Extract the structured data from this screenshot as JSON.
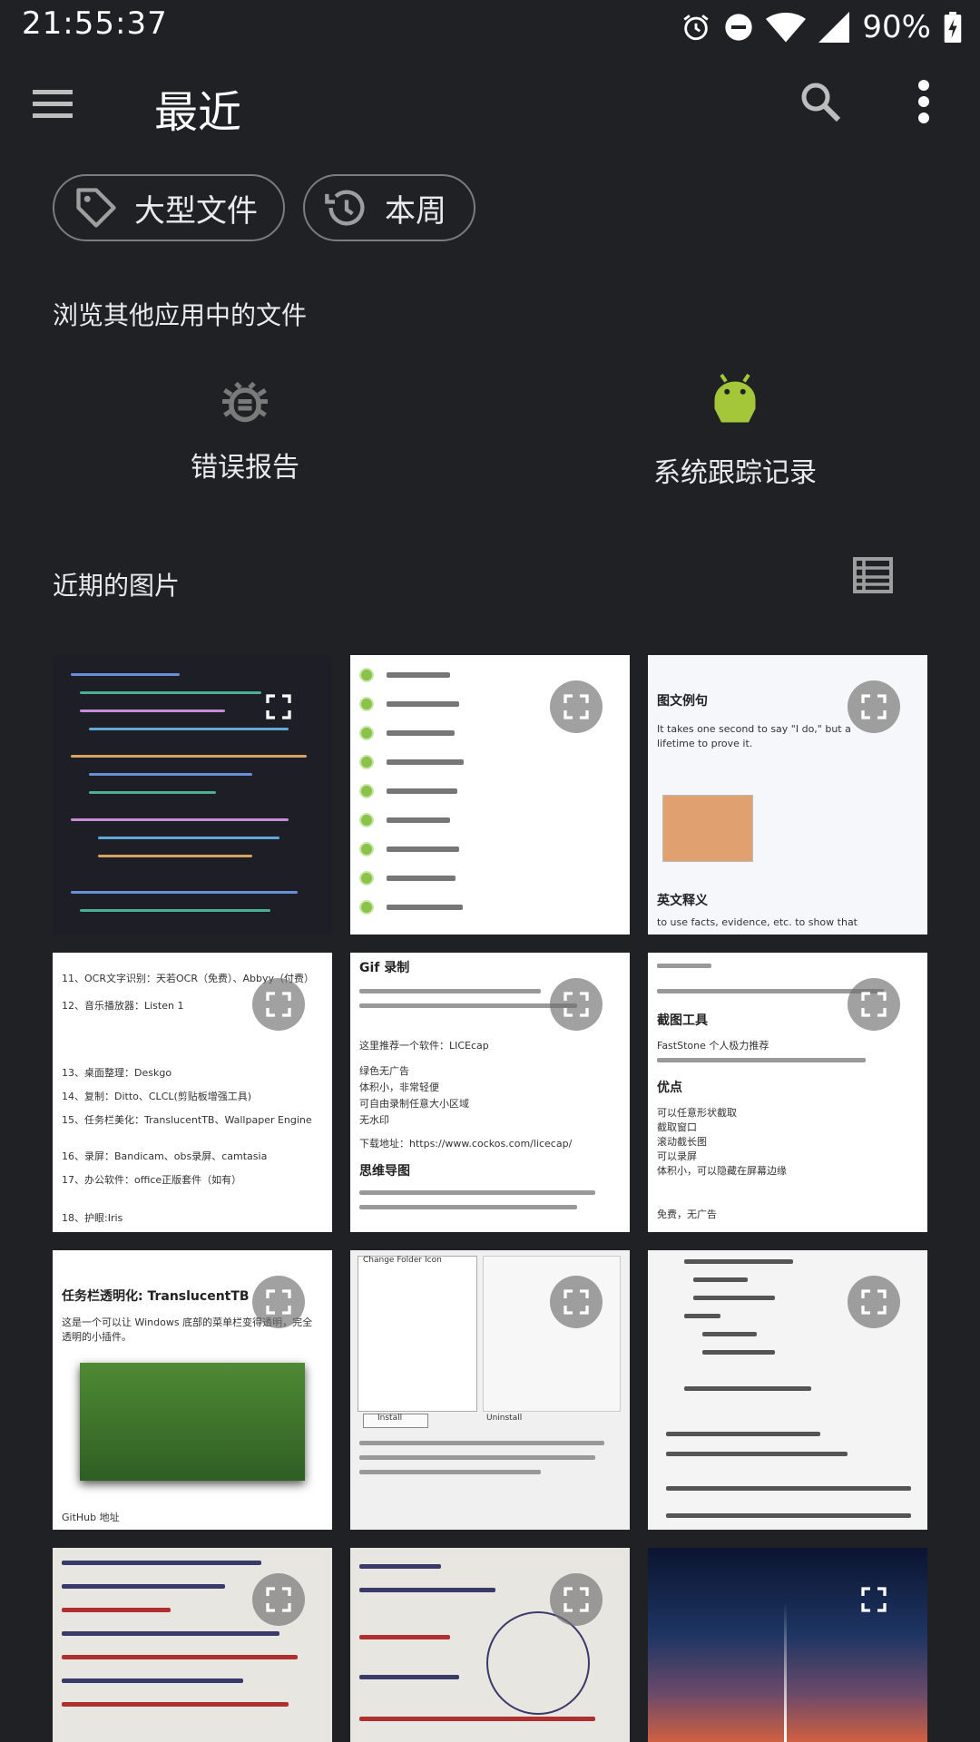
{
  "status_bar": {
    "time": "21:55:37",
    "battery_percent": "90%",
    "icons": [
      "alarm-icon",
      "do-not-disturb-icon",
      "wifi-icon",
      "signal-icon",
      "battery-charging-icon"
    ]
  },
  "app_bar": {
    "title": "最近",
    "icons": [
      "menu-icon",
      "search-icon",
      "more-vert-icon"
    ]
  },
  "chips": [
    {
      "label": "大型文件",
      "icon": "tag-icon"
    },
    {
      "label": "本周",
      "icon": "history-icon"
    }
  ],
  "browse_section": {
    "title": "浏览其他应用中的文件",
    "apps": [
      {
        "label": "错误报告",
        "icon": "bug-icon"
      },
      {
        "label": "系统跟踪记录",
        "icon": "android-icon",
        "color": "#a4c639"
      }
    ]
  },
  "recent_images": {
    "title": "近期的图片",
    "view_toggle_icon": "list-view-icon",
    "thumbnails": [
      {
        "kind": "code-screenshot"
      },
      {
        "kind": "checklist-screenshot"
      },
      {
        "kind": "dictionary-screenshot",
        "heading": "图文例句",
        "sentence": "It takes one second to say \"I do,\" but a lifetime to prove it.",
        "section": "英文释义",
        "definition": "to use facts, evidence, etc. to show that"
      },
      {
        "kind": "article-screenshot",
        "lines": [
          "11、OCR文字识别：天若OCR（免费）、Abbyy（付费）",
          "12、音乐播放器：Listen 1",
          "13、桌面整理：Deskgo",
          "14、复制：Ditto、CLCL(剪贴板增强工具)",
          "15、任务栏美化：TranslucentTB、Wallpaper Engine",
          "16、录屏：Bandicam、obs录屏、camtasia",
          "17、办公软件：office正版套件（如有）",
          "18、护眼:Iris"
        ]
      },
      {
        "kind": "article-screenshot",
        "heading": "Gif 录制",
        "lines": [
          "这里推荐一个软件：LICEcap",
          "绿色无广告",
          "体积小，非常轻便",
          "可自由录制任意大小区域",
          "无水印",
          "下载地址：https://www.cockos.com/licecap/"
        ],
        "heading2": "思维导图"
      },
      {
        "kind": "article-screenshot",
        "heading": "截图工具",
        "lines": [
          "FastStone 个人极力推荐",
          "可以任意形状截取",
          "截取窗口",
          "滚动截长图",
          "可以录屏",
          "体积小，可以隐藏在屏幕边缘",
          "免费，无广告"
        ],
        "heading2": "优点"
      },
      {
        "kind": "article-screenshot",
        "heading": "任务栏透明化: TranslucentTB",
        "lines": [
          "这是一个可以让 Windows 底部的菜单栏变得透明，完全透明的小插件。",
          "GitHub 地址"
        ]
      },
      {
        "kind": "dialog-screenshot",
        "lines": [
          "Change Folder Icon",
          "Install",
          "Uninstall"
        ]
      },
      {
        "kind": "code-photo"
      },
      {
        "kind": "handwritten-notes"
      },
      {
        "kind": "handwritten-notes"
      },
      {
        "kind": "night-sky-photo"
      }
    ]
  },
  "colors": {
    "background": "#202124",
    "text": "#e8eaed",
    "chip_border": "#7a7c80",
    "android_green": "#a4c639"
  }
}
